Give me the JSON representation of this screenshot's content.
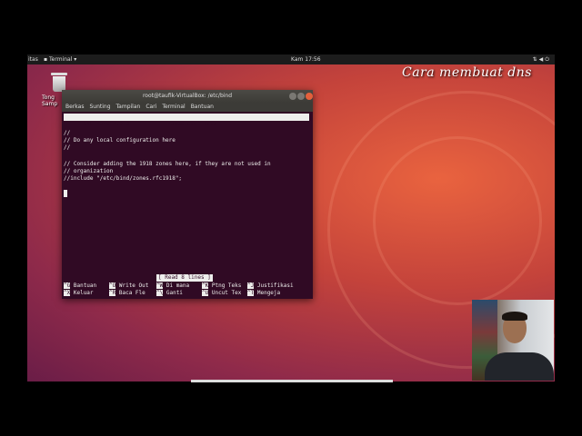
{
  "topbar": {
    "activities_label": "itas",
    "app_label": "Terminal ▾",
    "clock": "Kam 17:56",
    "tray_icons": [
      "network-icon",
      "volume-icon",
      "power-icon"
    ]
  },
  "desktop": {
    "trash_label": "Tong Samp"
  },
  "overlay": {
    "title": "Cara membuat dns"
  },
  "terminal": {
    "title": "root@taufik-VirtualBox: /etc/bind",
    "menu": [
      "Berkas",
      "Sunting",
      "Tampilan",
      "Cari",
      "Terminal",
      "Bantuan"
    ],
    "nano_version": "  GNU nano 2.9.3",
    "filename": "named.conf.local",
    "lines": [
      "//",
      "// Do any local configuration here",
      "//",
      "",
      "// Consider adding the 1918 zones here, if they are not used in",
      "// organization",
      "//include \"/etc/bind/zones.rfc1918\";"
    ],
    "status": "[ Read 8 lines ]",
    "shortcuts": [
      {
        "key": "^G",
        "label": "Bantuan"
      },
      {
        "key": "^O",
        "label": "Write Out"
      },
      {
        "key": "^W",
        "label": "Di mana"
      },
      {
        "key": "^K",
        "label": "Ptng Teks"
      },
      {
        "key": "^J",
        "label": "Justifikasi"
      },
      {
        "key": "^X",
        "label": "Keluar"
      },
      {
        "key": "^R",
        "label": "Baca Fle"
      },
      {
        "key": "^\\",
        "label": "Ganti"
      },
      {
        "key": "^U",
        "label": "Uncut Tex"
      },
      {
        "key": "^T",
        "label": "Mengeja"
      }
    ]
  },
  "colors": {
    "terminal_bg": "#300a24",
    "desktop_accent": "#e9633f",
    "close_button": "#e4603c"
  }
}
